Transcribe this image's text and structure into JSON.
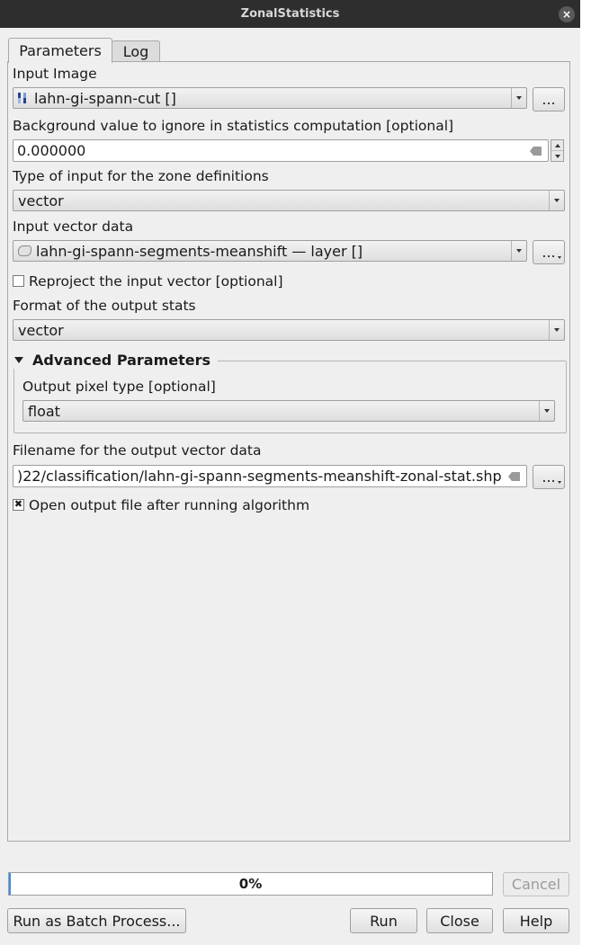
{
  "window": {
    "title": "ZonalStatistics"
  },
  "tabs": {
    "parameters": "Parameters",
    "log": "Log"
  },
  "params": {
    "input_image": {
      "label": "Input Image",
      "value": "lahn-gi-spann-cut []",
      "browse": "..."
    },
    "background": {
      "label": "Background value to ignore in statistics computation [optional]",
      "value": "0.000000"
    },
    "zone_type": {
      "label": "Type of input for the zone definitions",
      "value": "vector"
    },
    "input_vector": {
      "label": "Input vector data",
      "value": "lahn-gi-spann-segments-meanshift — layer []",
      "browse": "..."
    },
    "reproject": {
      "label": "Reproject the input vector [optional]",
      "checked": false
    },
    "output_format": {
      "label": "Format of the output stats",
      "value": "vector"
    },
    "advanced": {
      "title": "Advanced Parameters",
      "pixel_type": {
        "label": "Output pixel type [optional]",
        "value": "float"
      }
    },
    "output_file": {
      "label": "Filename for the output vector data",
      "value": ")22/classification/lahn-gi-spann-segments-meanshift-zonal-stat.shp",
      "browse": "..."
    },
    "open_output": {
      "label": "Open output file after running algorithm",
      "checked": true,
      "mark": "✖"
    }
  },
  "progress": {
    "value": 0,
    "text": "0%"
  },
  "buttons": {
    "cancel": "Cancel",
    "batch": "Run as Batch Process...",
    "run": "Run",
    "close": "Close",
    "help": "Help"
  },
  "icons": {
    "close": "×"
  }
}
